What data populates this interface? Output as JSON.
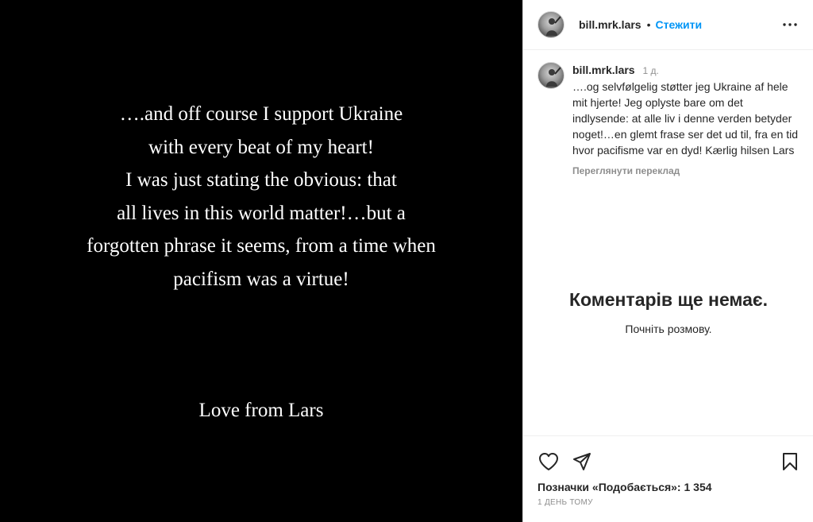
{
  "media": {
    "lines": [
      "….and off course I support Ukraine",
      "with every beat of my heart!",
      "I was just stating the obvious: that",
      "all lives in this world matter!…but a",
      "forgotten phrase it seems, from a time when",
      "pacifism was a virtue!"
    ],
    "signature": "Love from Lars"
  },
  "header": {
    "username": "bill.mrk.lars",
    "separator": "•",
    "follow_label": "Стежити",
    "more_icon": "more-options-icon"
  },
  "caption": {
    "username": "bill.mrk.lars",
    "time": "1 д.",
    "text": "….og selvfølgelig støtter jeg Ukraine af hele mit hjerte! Jeg oplyste bare om det indlysende: at alle liv i denne verden betyder noget!…en glemt frase ser det ud til, fra en tid hvor pacifisme var en dyd! Kærlig hilsen Lars",
    "see_translation": "Переглянути переклад"
  },
  "comments": {
    "empty_title": "Коментарів ще немає.",
    "empty_subtitle": "Почніть розмову."
  },
  "actions": {
    "like_icon": "heart-icon",
    "share_icon": "paper-plane-icon",
    "save_icon": "bookmark-icon",
    "likes_text": "Позначки «Подобається»: 1 354",
    "timestamp": "1 день тому"
  },
  "colors": {
    "accent": "#0095f6",
    "text": "#262626",
    "muted": "#8e8e8e",
    "media_bg": "#000000"
  }
}
